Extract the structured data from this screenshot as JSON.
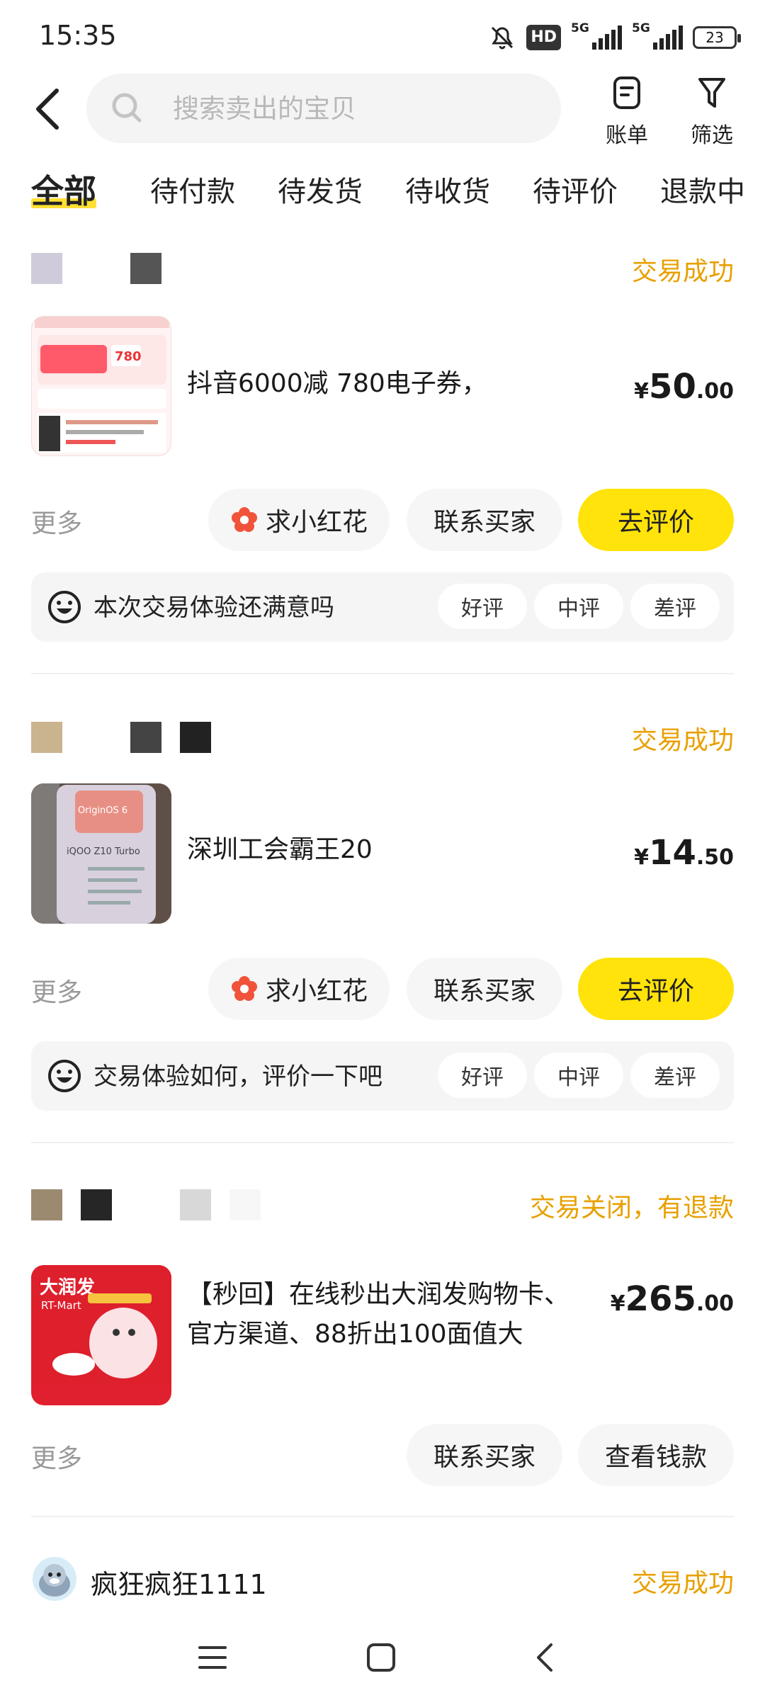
{
  "status_bar": {
    "time": "15:35",
    "hd": "HD",
    "net1": "5G",
    "net2": "5G",
    "battery": "23"
  },
  "search": {
    "placeholder": "搜索卖出的宝贝"
  },
  "header": {
    "bill_label": "账单",
    "filter_label": "筛选"
  },
  "tabs": [
    "全部",
    "待付款",
    "待发货",
    "待收货",
    "待评价",
    "退款中"
  ],
  "orders": [
    {
      "status": "交易成功",
      "title": "抖音6000减 780电子券，",
      "price": {
        "symbol": "¥",
        "int": "50",
        "dec": ".00"
      },
      "more": "更多",
      "actions": [
        "求小红花",
        "联系买家",
        "去评价"
      ],
      "survey": {
        "question": "本次交易体验还满意吗",
        "options": [
          "好评",
          "中评",
          "差评"
        ]
      }
    },
    {
      "status": "交易成功",
      "title": "深圳工会霸王20",
      "price": {
        "symbol": "¥",
        "int": "14",
        "dec": ".50"
      },
      "more": "更多",
      "actions": [
        "求小红花",
        "联系买家",
        "去评价"
      ],
      "survey": {
        "question": "交易体验如何，评价一下吧",
        "options": [
          "好评",
          "中评",
          "差评"
        ]
      }
    },
    {
      "status": "交易关闭，有退款",
      "title_line1": "【秒回】在线秒出大润发购物卡、",
      "title_line2": "官方渠道、88折出100面值大",
      "price": {
        "symbol": "¥",
        "int": "265",
        "dec": ".00"
      },
      "more": "更多",
      "actions": [
        "联系买家",
        "查看钱款"
      ]
    },
    {
      "buyer": "疯狂疯狂1111",
      "status": "交易成功"
    }
  ],
  "thumb_text": {
    "o1_a": "780",
    "o2_brand": "OriginOS 6",
    "o2_model": "iQOO Z10 Turbo",
    "o3_brand": "大润发",
    "o3_sub": "RT-Mart"
  },
  "colors": {
    "accent_yellow": "#ffe30a",
    "status_orange": "#e8a000",
    "flower_red": "#f0533a"
  },
  "icons": [
    "back-icon",
    "search-icon",
    "bill-icon",
    "filter-icon",
    "flower-icon",
    "smiley-icon",
    "menu-icon",
    "home-icon",
    "nav-back-icon"
  ]
}
